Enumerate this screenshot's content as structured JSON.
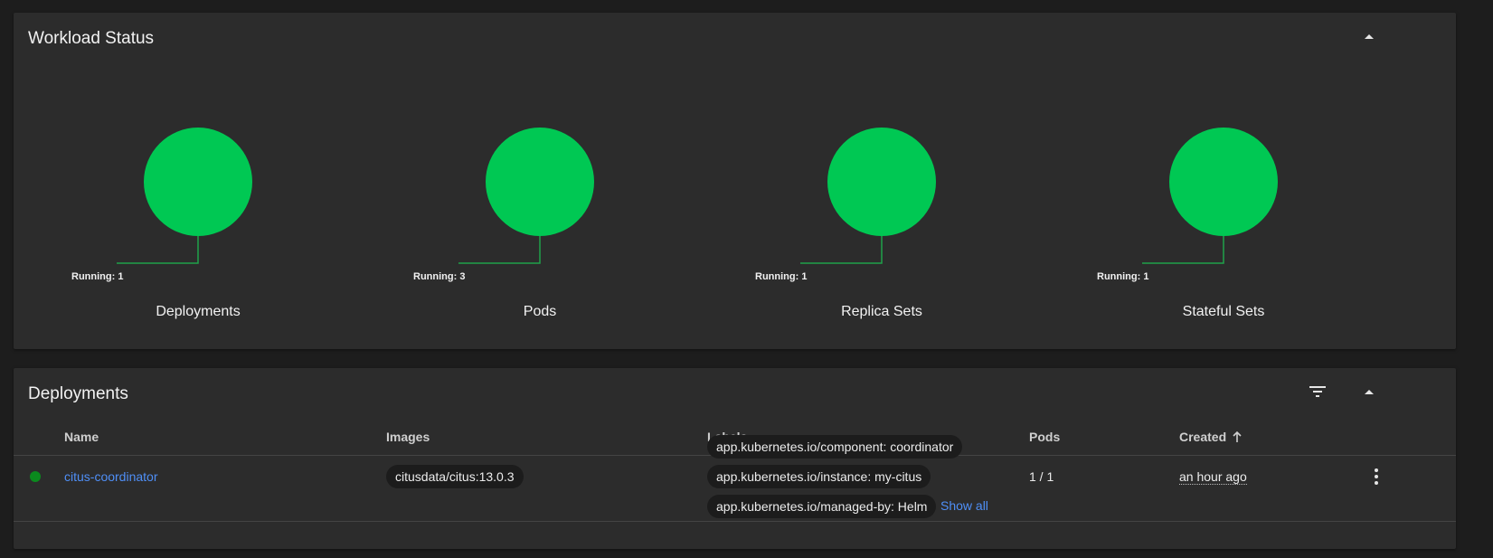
{
  "workload_status": {
    "title": "Workload Status",
    "accent_color": "#00c853",
    "charts": [
      {
        "label": "Deployments",
        "running_text": "Running: 1",
        "running": 1
      },
      {
        "label": "Pods",
        "running_text": "Running: 3",
        "running": 3
      },
      {
        "label": "Replica Sets",
        "running_text": "Running: 1",
        "running": 1
      },
      {
        "label": "Stateful Sets",
        "running_text": "Running: 1",
        "running": 1
      }
    ],
    "collapse_icon": "chevron-up-icon"
  },
  "deployments": {
    "title": "Deployments",
    "filter_icon": "filter-icon",
    "collapse_icon": "chevron-up-icon",
    "columns": {
      "name": "Name",
      "images": "Images",
      "labels": "Labels",
      "pods": "Pods",
      "created": "Created",
      "created_sort_icon": "arrow-up-icon"
    },
    "rows": [
      {
        "status_icon": "status-running-icon",
        "status_color": "#0b8a1e",
        "name": "citus-coordinator",
        "image": "citusdata/citus:13.0.3",
        "labels": [
          "app.kubernetes.io/component: coordinator",
          "app.kubernetes.io/instance: my-citus",
          "app.kubernetes.io/managed-by: Helm"
        ],
        "show_all": "Show all",
        "pods": "1 / 1",
        "created": "an hour ago",
        "menu_icon": "more-vert-icon"
      }
    ]
  }
}
